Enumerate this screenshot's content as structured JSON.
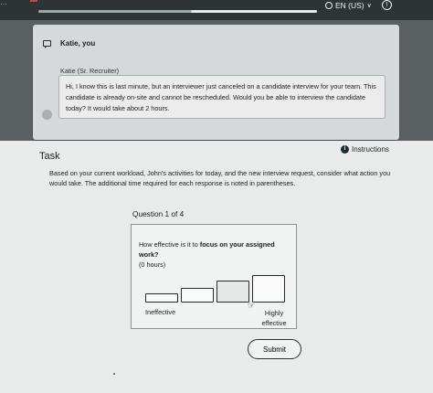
{
  "top_bar": {
    "progress": 0.55,
    "language": "EN (US)",
    "icons": {
      "globe": "globe-icon",
      "chevron": "chevron-down-icon",
      "help": "help-icon"
    }
  },
  "chat": {
    "title": "Katie, you",
    "sender": "Katie (Sr. Recruiter)",
    "message": "Hi, I know this is last minute, but an interviewer just canceled on a candidate interview for your team. This candidate is already on-site and cannot be rescheduled. Would you be able to interview the candidate today? It would take about 2 hours."
  },
  "task": {
    "title": "Task",
    "instructions_label": "Instructions",
    "description": "Based on your current workload, John's activities for today, and the new interview request, consider what action you would take. The additional time required for each response is noted in parentheses."
  },
  "question": {
    "counter": "Question 1 of 4",
    "prompt_prefix": "How effective is it to ",
    "prompt_emphasis": "focus on your assigned work?",
    "prompt_suffix": "(0 hours)",
    "scale_low_label": "Ineffective",
    "scale_high_label": "Highly effective"
  },
  "submit_label": "Submit"
}
